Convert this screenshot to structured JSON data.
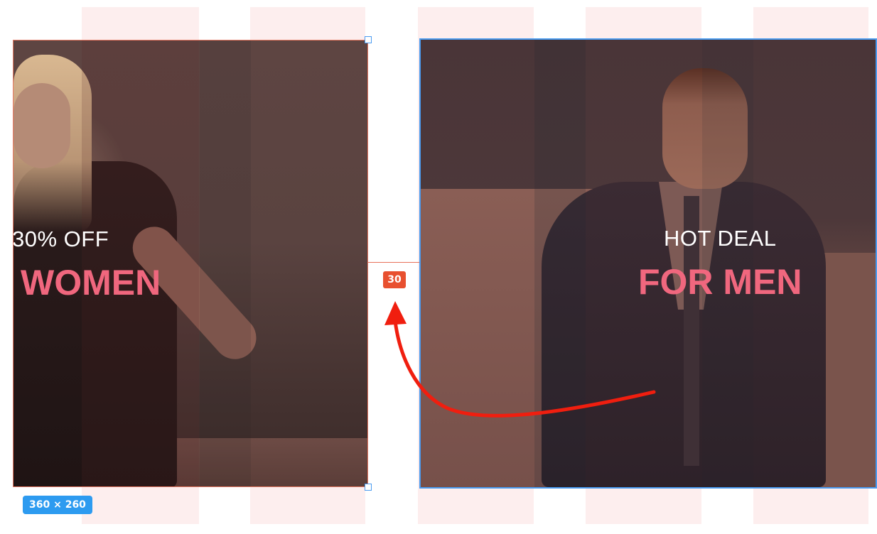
{
  "canvas": {
    "grid_color": "#fdeeee",
    "selection_color": "#4a9bf0",
    "spacing_color": "#e8502f",
    "accent_pink": "#f0677e"
  },
  "left_banner": {
    "subtitle": "30% OFF",
    "title": "WOMEN"
  },
  "right_banner": {
    "subtitle": "HOT DEAL",
    "title": "FOR MEN"
  },
  "spacing_indicator": {
    "value": "30"
  },
  "size_indicator": {
    "label": "360 × 260"
  },
  "icons": {
    "annotation_arrow": "curved-arrow-icon"
  }
}
